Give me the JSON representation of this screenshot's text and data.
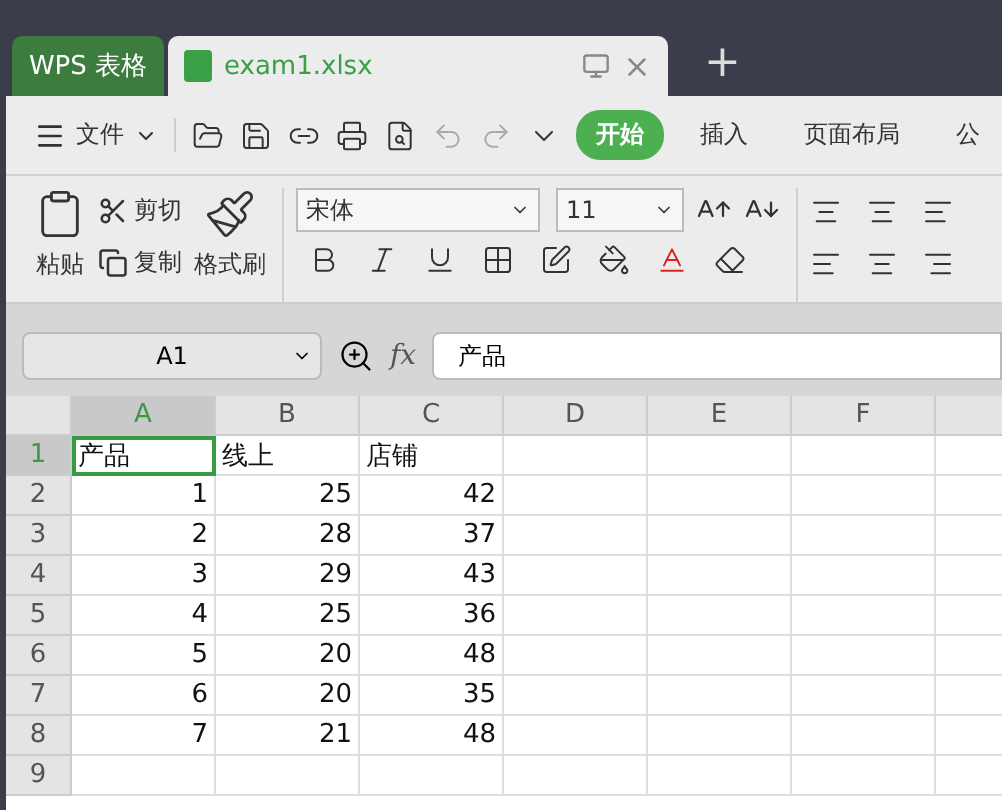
{
  "app_tab": "WPS 表格",
  "doc_tab": {
    "title": "exam1.xlsx",
    "selected": true
  },
  "new_tab": "+",
  "menu": {
    "file": "文件",
    "tabs": [
      {
        "label": "开始",
        "selected": true
      },
      {
        "label": "插入",
        "selected": false
      },
      {
        "label": "页面布局",
        "selected": false
      },
      {
        "label": "公",
        "selected": false
      }
    ]
  },
  "ribbon": {
    "paste": "粘贴",
    "cut": "剪切",
    "copy": "复制",
    "format_painter": "格式刷",
    "font": "宋体",
    "size": "11"
  },
  "formula_bar": {
    "cell_ref": "A1",
    "fx": "fx",
    "value": "产品"
  },
  "sheet": {
    "columns": [
      {
        "label": "A",
        "selected": true
      },
      {
        "label": "B",
        "selected": false
      },
      {
        "label": "C",
        "selected": false
      },
      {
        "label": "D",
        "selected": false
      },
      {
        "label": "E",
        "selected": false
      },
      {
        "label": "F",
        "selected": false
      }
    ],
    "rows": [
      {
        "label": "1",
        "kind": "header",
        "selected": true,
        "cells": [
          "产品",
          "线上",
          "店铺"
        ]
      },
      {
        "label": "2",
        "kind": "data",
        "selected": false,
        "cells": [
          "1",
          "25",
          "42"
        ]
      },
      {
        "label": "3",
        "kind": "data",
        "selected": false,
        "cells": [
          "2",
          "28",
          "37"
        ]
      },
      {
        "label": "4",
        "kind": "data",
        "selected": false,
        "cells": [
          "3",
          "29",
          "43"
        ]
      },
      {
        "label": "5",
        "kind": "data",
        "selected": false,
        "cells": [
          "4",
          "25",
          "36"
        ]
      },
      {
        "label": "6",
        "kind": "data",
        "selected": false,
        "cells": [
          "5",
          "20",
          "48"
        ]
      },
      {
        "label": "7",
        "kind": "data",
        "selected": false,
        "cells": [
          "6",
          "20",
          "35"
        ]
      },
      {
        "label": "8",
        "kind": "data",
        "selected": false,
        "cells": [
          "7",
          "21",
          "48"
        ]
      },
      {
        "label": "9",
        "kind": "data",
        "selected": false
      }
    ]
  }
}
